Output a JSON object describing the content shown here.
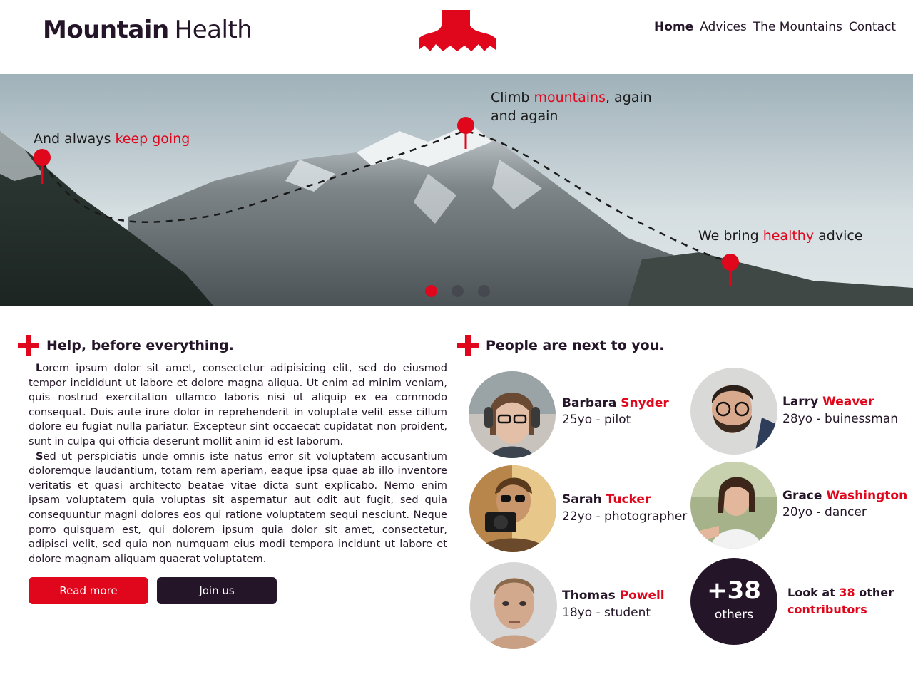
{
  "brand": {
    "part1": "Mountain",
    "part2": "Health"
  },
  "nav": {
    "items": [
      "Home",
      "Advices",
      "The Mountains",
      "Contact"
    ],
    "active": "Home"
  },
  "hero": {
    "captions": [
      {
        "pre": "And always ",
        "highlight": "keep going",
        "post": ""
      },
      {
        "pre": "Climb ",
        "highlight": "mountains",
        "post": ", again",
        "line2": "and again"
      },
      {
        "pre": "We bring ",
        "highlight": "healthy",
        "post": " advice"
      }
    ],
    "slides": 3,
    "active_slide": 1
  },
  "help": {
    "title": "Help, before everything.",
    "p1_cap": "L",
    "p1": "orem ipsum dolor sit amet, consectetur adipisicing elit, sed do eiusmod tempor incididunt ut labore et dolore magna aliqua. Ut enim ad minim veniam, quis nostrud exercitation ullamco laboris nisi ut aliquip ex ea commodo consequat. Duis aute irure dolor in reprehenderit in voluptate velit esse cillum dolore eu fugiat nulla pariatur. Excepteur sint occaecat cupidatat non proident, sunt in culpa qui officia deserunt mollit anim id est laborum.",
    "p2_cap": "S",
    "p2": "ed ut perspiciatis unde omnis iste natus error sit voluptatem accusantium doloremque laudantium, totam rem aperiam, eaque ipsa quae ab illo inventore veritatis et quasi architecto beatae vitae dicta sunt explicabo. Nemo enim ipsam voluptatem quia voluptas sit aspernatur aut odit aut fugit, sed quia consequuntur magni dolores eos qui ratione voluptatem sequi nesciunt. Neque porro quisquam est, qui dolorem ipsum quia dolor sit amet, consectetur, adipisci velit, sed quia non numquam eius modi tempora incidunt ut labore et dolore magnam aliquam quaerat voluptatem.",
    "read_more": "Read more",
    "join_us": "Join us"
  },
  "people": {
    "title": "People are next to you.",
    "list": [
      {
        "first": "Barbara",
        "last": "Snyder",
        "info": "25yo - pilot"
      },
      {
        "first": "Larry",
        "last": "Weaver",
        "info": "28yo - buinessman"
      },
      {
        "first": "Sarah",
        "last": "Tucker",
        "info": "22yo - photographer"
      },
      {
        "first": "Grace",
        "last": "Washington",
        "info": "20yo - dancer"
      },
      {
        "first": "Thomas",
        "last": "Powell",
        "info": "18yo - student"
      }
    ],
    "others_count": "+38",
    "others_label": "others",
    "contrib_pre": "Look at ",
    "contrib_num": "38",
    "contrib_post": " other",
    "contrib_line2": "contributors"
  },
  "colors": {
    "accent": "#e0061b",
    "dark": "#241628"
  }
}
